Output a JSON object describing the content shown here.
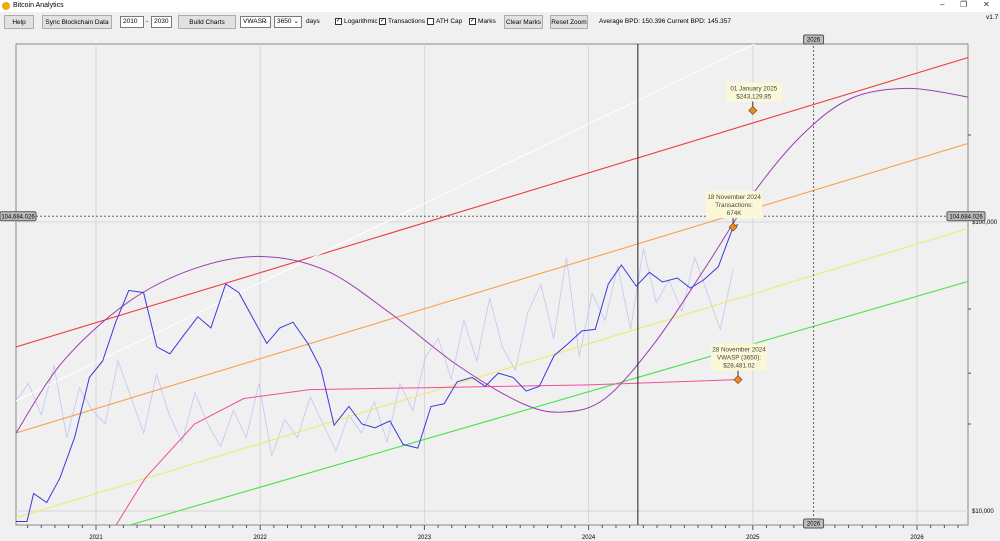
{
  "window": {
    "title": "Bitcoin Analytics",
    "version": "v1.7",
    "minimize": "–",
    "restore": "❐",
    "close": "✕"
  },
  "toolbar": {
    "help": "Help",
    "sync": "Sync Blockchain Data",
    "year_from": "2010",
    "dash": "-",
    "year_to": "2030",
    "build": "Build Charts",
    "metric": "VWASP",
    "days_value": "3650",
    "days_label": "days",
    "logarithmic": {
      "label": "Logarithmic",
      "checked": true
    },
    "transactions": {
      "label": "Transactions",
      "checked": true
    },
    "ath_cap": {
      "label": "ATH Cap",
      "checked": false
    },
    "marks": {
      "label": "Marks",
      "checked": true
    },
    "clear_marks": "Clear Marks",
    "reset_zoom": "Reset Zoom",
    "average_bpd": "Average BPD: 150.396",
    "current_bpd": "Current BPD: 145.357"
  },
  "colors": {
    "price": "#3a3adf",
    "transactions": "#c4c4f4",
    "red": "#ee3b3b",
    "orange": "#f7a048",
    "yellow": "#eeea6e",
    "green": "#4be24b",
    "purple": "#9a3fb0",
    "vwasp": "#ee4f9a",
    "marker": "#f08a24"
  },
  "chart_data": {
    "type": "line",
    "yscale": "log",
    "xlim": [
      2020.51,
      2026.32
    ],
    "ylim": [
      7000,
      600000
    ],
    "x_ticks": [
      "2021",
      "2022",
      "2023",
      "2024",
      "2025",
      "2026"
    ],
    "y_ticks": [
      {
        "value": 10000,
        "label": "$10,000"
      },
      {
        "value": 100000,
        "label": "$100,000"
      }
    ],
    "crosshair": {
      "price_label": "104,684.026",
      "price": 104684.026,
      "year_label": "2026",
      "year": 2025.37
    },
    "cursor_line_year": 2024.3,
    "bands": [
      {
        "key": "red",
        "points": [
          [
            2020.51,
            36900
          ],
          [
            2026.32,
            372000
          ]
        ]
      },
      {
        "key": "orange",
        "points": [
          [
            2020.51,
            18600
          ],
          [
            2026.32,
            187600
          ]
        ]
      },
      {
        "key": "yellow",
        "points": [
          [
            2020.51,
            9460
          ],
          [
            2026.32,
            95300
          ]
        ]
      },
      {
        "key": "green",
        "points": [
          [
            2021.21,
            8950
          ],
          [
            2026.32,
            62500
          ]
        ]
      },
      {
        "key": "white",
        "points": [
          [
            2020.51,
            24000
          ],
          [
            2025.6,
            600000
          ]
        ]
      }
    ],
    "cycle": [
      [
        2020.51,
        18500
      ],
      [
        2020.8,
        33000
      ],
      [
        2021.2,
        53000
      ],
      [
        2021.6,
        69000
      ],
      [
        2022.0,
        76000
      ],
      [
        2022.4,
        68000
      ],
      [
        2022.8,
        48000
      ],
      [
        2023.2,
        32000
      ],
      [
        2023.6,
        23500
      ],
      [
        2023.85,
        22000
      ],
      [
        2024.1,
        24500
      ],
      [
        2024.4,
        38000
      ],
      [
        2024.7,
        68000
      ],
      [
        2025.0,
        125000
      ],
      [
        2025.3,
        200000
      ],
      [
        2025.6,
        268000
      ],
      [
        2025.95,
        290000
      ],
      [
        2026.32,
        270000
      ]
    ],
    "price": [
      [
        2020.51,
        9200
      ],
      [
        2020.58,
        9200
      ],
      [
        2020.62,
        11500
      ],
      [
        2020.7,
        10700
      ],
      [
        2020.78,
        13000
      ],
      [
        2020.87,
        18000
      ],
      [
        2020.96,
        29000
      ],
      [
        2021.04,
        33000
      ],
      [
        2021.12,
        45000
      ],
      [
        2021.2,
        58000
      ],
      [
        2021.29,
        57000
      ],
      [
        2021.37,
        37000
      ],
      [
        2021.45,
        35000
      ],
      [
        2021.54,
        41000
      ],
      [
        2021.62,
        47000
      ],
      [
        2021.7,
        43000
      ],
      [
        2021.79,
        61000
      ],
      [
        2021.87,
        57000
      ],
      [
        2021.96,
        46000
      ],
      [
        2022.04,
        38000
      ],
      [
        2022.12,
        43000
      ],
      [
        2022.2,
        45000
      ],
      [
        2022.29,
        38000
      ],
      [
        2022.37,
        31000
      ],
      [
        2022.45,
        19800
      ],
      [
        2022.54,
        23000
      ],
      [
        2022.62,
        20000
      ],
      [
        2022.7,
        19400
      ],
      [
        2022.79,
        20500
      ],
      [
        2022.87,
        17000
      ],
      [
        2022.96,
        16500
      ],
      [
        2023.04,
        23000
      ],
      [
        2023.12,
        23500
      ],
      [
        2023.2,
        28000
      ],
      [
        2023.29,
        29000
      ],
      [
        2023.37,
        27000
      ],
      [
        2023.45,
        30000
      ],
      [
        2023.54,
        29000
      ],
      [
        2023.62,
        26000
      ],
      [
        2023.7,
        27000
      ],
      [
        2023.79,
        34500
      ],
      [
        2023.87,
        37700
      ],
      [
        2023.96,
        42000
      ],
      [
        2024.04,
        42500
      ],
      [
        2024.12,
        61000
      ],
      [
        2024.2,
        71000
      ],
      [
        2024.29,
        60000
      ],
      [
        2024.37,
        67000
      ],
      [
        2024.45,
        62000
      ],
      [
        2024.54,
        64000
      ],
      [
        2024.62,
        59000
      ],
      [
        2024.7,
        63000
      ],
      [
        2024.79,
        70000
      ],
      [
        2024.88,
        96000
      ],
      [
        2024.91,
        98000
      ]
    ],
    "vwasp": [
      [
        2021.12,
        8900
      ],
      [
        2021.3,
        13000
      ],
      [
        2021.6,
        20000
      ],
      [
        2021.9,
        24500
      ],
      [
        2022.3,
        26300
      ],
      [
        2023.0,
        26700
      ],
      [
        2024.0,
        27300
      ],
      [
        2024.91,
        28481.02
      ]
    ],
    "transactions_k": [
      380,
      420,
      350,
      460,
      300,
      410,
      360,
      330,
      470,
      390,
      310,
      440,
      350,
      290,
      400,
      330,
      280,
      360,
      300,
      420,
      260,
      340,
      300,
      390,
      330,
      270,
      350,
      310,
      380,
      290,
      420,
      360,
      480,
      520,
      430,
      560,
      470,
      610,
      500,
      450,
      580,
      640,
      520,
      700,
      480,
      620,
      560,
      680,
      540,
      720,
      600,
      650,
      580,
      700,
      620,
      540,
      674
    ],
    "marks": [
      {
        "date": "01 January 2025",
        "line1": "$243,129.85",
        "line2": "",
        "x": 2025.0,
        "y": 243129.85
      },
      {
        "date": "18 November 2024",
        "line1": "Transactions:",
        "line2": "674K",
        "x": 2024.88,
        "y": 96000
      },
      {
        "date": "28 November 2024",
        "line1": "VWASP (3650):",
        "line2": "$28,481.02",
        "x": 2024.91,
        "y": 28481.02
      }
    ]
  }
}
